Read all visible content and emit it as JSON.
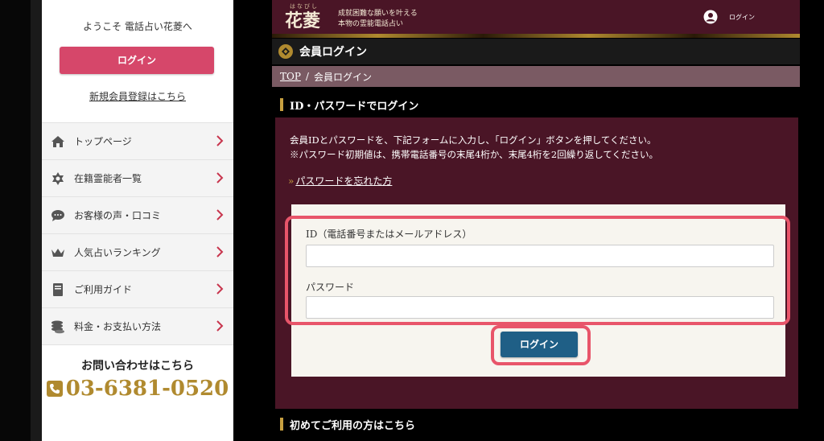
{
  "sidebar": {
    "welcome": "ようこそ 電話占い花菱へ",
    "login_label": "ログイン",
    "register_label": "新規会員登録はこちら",
    "nav": [
      {
        "label": "トップページ",
        "icon": "home-icon"
      },
      {
        "label": "在籍霊能者一覧",
        "icon": "star-of-david-icon"
      },
      {
        "label": "お客様の声・口コミ",
        "icon": "speech-bubble-icon"
      },
      {
        "label": "人気占いランキング",
        "icon": "crown-icon"
      },
      {
        "label": "ご利用ガイド",
        "icon": "book-icon"
      },
      {
        "label": "料金・お支払い方法",
        "icon": "coins-icon"
      }
    ],
    "contact_label": "お問い合わせはこちら",
    "phone": "03-6381-0520"
  },
  "header": {
    "logo_ruby": "はなびし",
    "logo": "花菱",
    "tagline_line1": "成就困難な願いを叶える",
    "tagline_line2": "本物の霊能電話占い",
    "login_label": "ログイン"
  },
  "page": {
    "title": "会員ログイン",
    "breadcrumb": {
      "top": "TOP",
      "separator": "/",
      "current": "会員ログイン"
    },
    "section_title": "ID・パスワードでログイン",
    "description_line1": "会員IDとパスワードを、下記フォームに入力し、「ログイン」ボタンを押してください。",
    "description_line2": "※パスワード初期値は、携帯電話番号の末尾4桁か、末尾4桁を2回繰り返してください。",
    "forgot_chevron": "»",
    "forgot_link": "パスワードを忘れた方",
    "form": {
      "id_label": "ID（電話番号またはメールアドレス）",
      "id_value": "",
      "password_label": "パスワード",
      "password_value": "",
      "submit_label": "ログイン"
    },
    "first_time_title": "初めてご利用の方はこちら"
  },
  "colors": {
    "header_bg": "#4a1526",
    "sidebar_login_button": "#d6476a",
    "submit_button": "#1f5f86",
    "highlight": "#e8556a",
    "gold_accent": "#b08a2f"
  }
}
